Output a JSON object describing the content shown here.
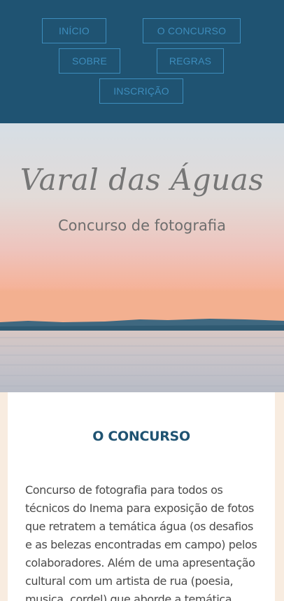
{
  "nav": {
    "items": [
      {
        "label": "INÍCIO"
      },
      {
        "label": "O CONCURSO"
      },
      {
        "label": "SOBRE"
      },
      {
        "label": "REGRAS"
      },
      {
        "label": "INSCRIÇÃO"
      }
    ],
    "colors": {
      "background": "#1f5372",
      "accent": "#3d8dbd"
    }
  },
  "hero": {
    "title": "Varal das Águas",
    "subtitle": "Concurso de fotografia"
  },
  "section": {
    "title": "O CONCURSO",
    "text": "Concurso de fotografia para todos os técnicos do Inema para exposição de fotos que retratem a temática água (os desafios e as belezas encontradas em campo) pelos colaboradores. Além de uma apresentação cultural com um artista de rua (poesia, musica, cordel) que aborde a temática água"
  }
}
